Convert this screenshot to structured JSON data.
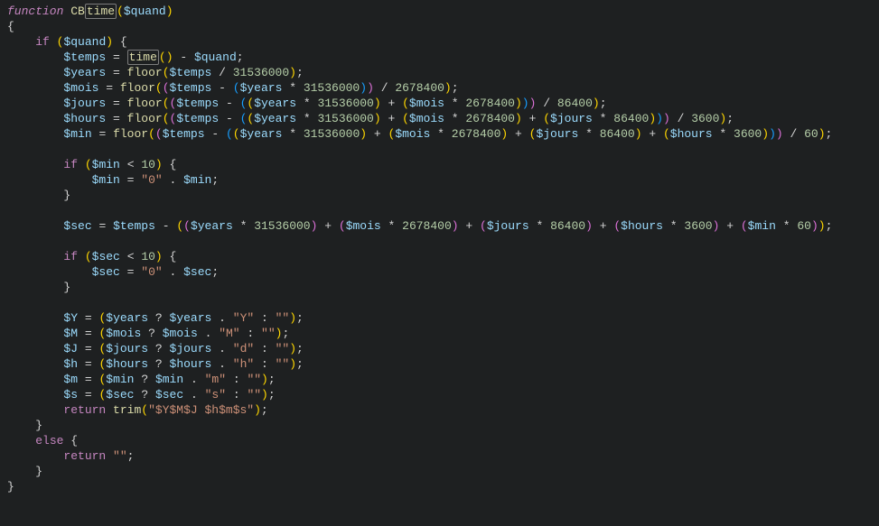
{
  "code": {
    "function_keyword": "function",
    "function_name_prefix": "CB",
    "function_name_boxed": "time",
    "param": "$quand",
    "if_keyword": "if",
    "else_keyword": "else",
    "return_keyword": "return",
    "time_call": "time",
    "floor_call": "floor",
    "trim_call": "trim",
    "vars": {
      "temps": "$temps",
      "years": "$years",
      "mois": "$mois",
      "jours": "$jours",
      "hours": "$hours",
      "min": "$min",
      "sec": "$sec",
      "Y": "$Y",
      "M": "$M",
      "J": "$J",
      "h": "$h",
      "m": "$m",
      "s": "$s",
      "quand": "$quand"
    },
    "nums": {
      "year_seconds": "31536000",
      "month_seconds": "2678400",
      "day_seconds": "86400",
      "hour_seconds": "3600",
      "minute_seconds": "60",
      "ten": "10"
    },
    "strs": {
      "zero": "\"0\"",
      "Y": "\"Y\"",
      "M": "\"M\"",
      "d": "\"d\"",
      "h": "\"h\"",
      "m": "\"m\"",
      "s": "\"s\"",
      "empty": "\"\"",
      "fmt": "\"$Y$M$J $h$m$s\""
    }
  }
}
